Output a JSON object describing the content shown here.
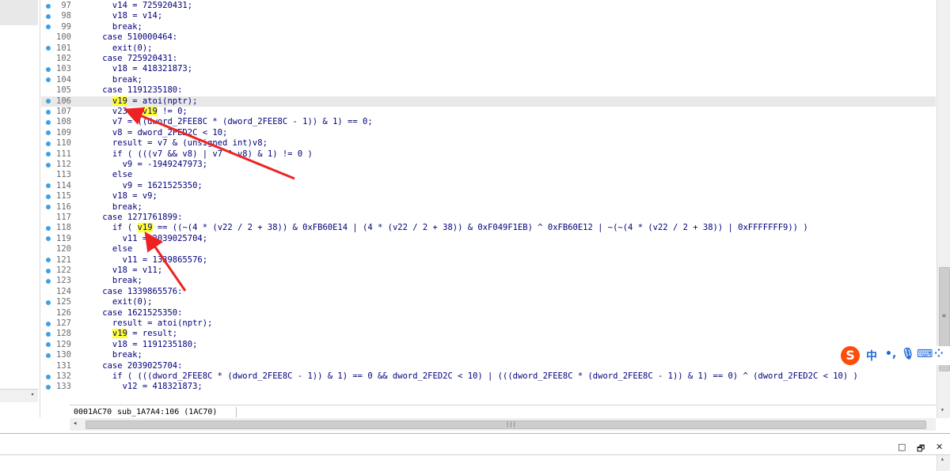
{
  "lines": [
    {
      "n": "97",
      "dot": true,
      "code": "      v14 = 725920431;"
    },
    {
      "n": "98",
      "dot": true,
      "code": "      v18 = v14;"
    },
    {
      "n": "99",
      "dot": true,
      "code": "      break;"
    },
    {
      "n": "100",
      "dot": false,
      "code": "    case 510000464:"
    },
    {
      "n": "101",
      "dot": true,
      "code": "      exit(0);"
    },
    {
      "n": "102",
      "dot": false,
      "code": "    case 725920431:"
    },
    {
      "n": "103",
      "dot": true,
      "code": "      v18 = 418321873;"
    },
    {
      "n": "104",
      "dot": true,
      "code": "      break;"
    },
    {
      "n": "105",
      "dot": false,
      "code": "    case 1191235180:"
    },
    {
      "n": "106",
      "dot": true,
      "code": "      v19 = atoi(nptr);"
    },
    {
      "n": "107",
      "dot": true,
      "code": "      v23 = v19 != 0;"
    },
    {
      "n": "108",
      "dot": true,
      "code": "      v7 = ((dword_2FEE8C * (dword_2FEE8C - 1)) & 1) == 0;"
    },
    {
      "n": "109",
      "dot": true,
      "code": "      v8 = dword_2FED2C < 10;"
    },
    {
      "n": "110",
      "dot": true,
      "code": "      result = v7 & (unsigned int)v8;"
    },
    {
      "n": "111",
      "dot": true,
      "code": "      if ( (((v7 && v8) | v7 ^ v8) & 1) != 0 )"
    },
    {
      "n": "112",
      "dot": true,
      "code": "        v9 = -1949247973;"
    },
    {
      "n": "113",
      "dot": false,
      "code": "      else"
    },
    {
      "n": "114",
      "dot": true,
      "code": "        v9 = 1621525350;"
    },
    {
      "n": "115",
      "dot": true,
      "code": "      v18 = v9;"
    },
    {
      "n": "116",
      "dot": true,
      "code": "      break;"
    },
    {
      "n": "117",
      "dot": false,
      "code": "    case 1271761899:"
    },
    {
      "n": "118",
      "dot": true,
      "code": "      if ( v19 == ((~(4 * (v22 / 2 + 38)) & 0xFB60E14 | (4 * (v22 / 2 + 38)) & 0xF049F1EB) ^ 0xFB60E12 | ~(~(4 * (v22 / 2 + 38)) | 0xFFFFFFF9)) )"
    },
    {
      "n": "119",
      "dot": true,
      "code": "        v11 = 2039025704;"
    },
    {
      "n": "120",
      "dot": false,
      "code": "      else"
    },
    {
      "n": "121",
      "dot": true,
      "code": "        v11 = 1339865576;"
    },
    {
      "n": "122",
      "dot": true,
      "code": "      v18 = v11;"
    },
    {
      "n": "123",
      "dot": true,
      "code": "      break;"
    },
    {
      "n": "124",
      "dot": false,
      "code": "    case 1339865576:"
    },
    {
      "n": "125",
      "dot": true,
      "code": "      exit(0);"
    },
    {
      "n": "126",
      "dot": false,
      "code": "    case 1621525350:"
    },
    {
      "n": "127",
      "dot": true,
      "code": "      result = atoi(nptr);"
    },
    {
      "n": "128",
      "dot": true,
      "code": "      v19 = result;"
    },
    {
      "n": "129",
      "dot": true,
      "code": "      v18 = 1191235180;"
    },
    {
      "n": "130",
      "dot": true,
      "code": "      break;"
    },
    {
      "n": "131",
      "dot": false,
      "code": "    case 2039025704:"
    },
    {
      "n": "132",
      "dot": true,
      "code": "      if ( (((dword_2FEE8C * (dword_2FEE8C - 1)) & 1) == 0 && dword_2FED2C < 10) | (((dword_2FEE8C * (dword_2FEE8C - 1)) & 1) == 0) ^ (dword_2FED2C < 10) )"
    },
    {
      "n": "133",
      "dot": true,
      "code": "        v12 = 418321873;"
    }
  ],
  "current_line": "106",
  "status": {
    "address": "0001AC70",
    "location": "sub_1A7A4:106 (1AC70)"
  },
  "window_buttons": {
    "restore": "□",
    "float": "🗗",
    "close": "✕"
  },
  "ime": {
    "logo": "S",
    "items": [
      "中",
      "•,",
      "🎙",
      "⌨",
      "⁘"
    ]
  },
  "colors": {
    "highlight": "#ffff33",
    "dot": "#3fa0e0",
    "arrow": "#ee2222",
    "code": "#00007b"
  }
}
